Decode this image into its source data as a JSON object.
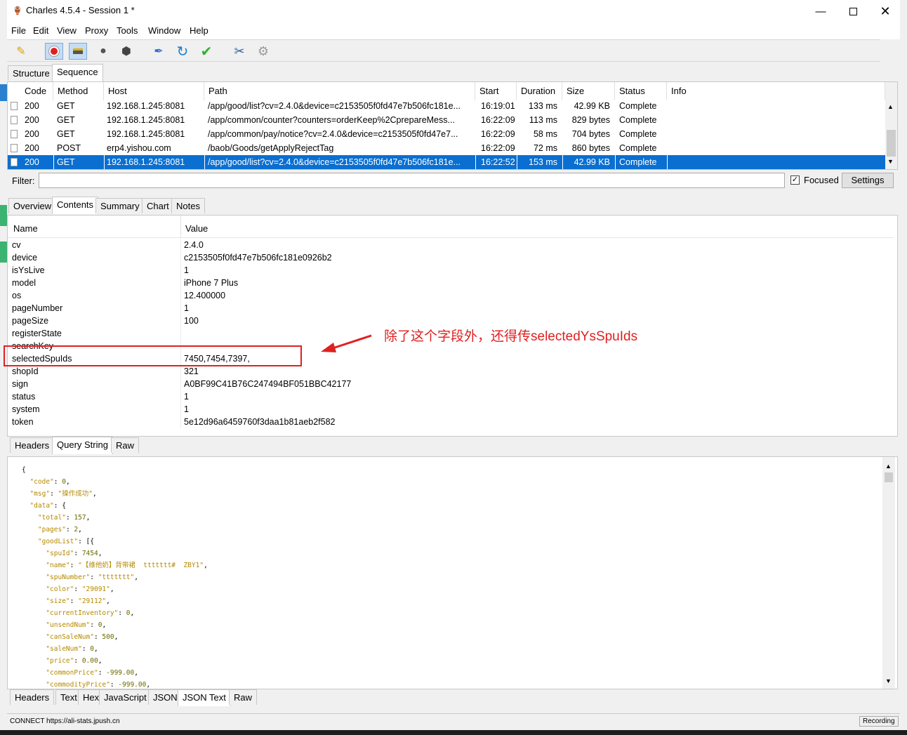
{
  "window": {
    "title": "Charles 4.5.4 - Session 1 *"
  },
  "menu": [
    "File",
    "Edit",
    "View",
    "Proxy",
    "Tools",
    "Window",
    "Help"
  ],
  "toolbar_icons": [
    "broom-icon",
    "record-icon",
    "throttle-icon",
    "turtle-icon",
    "stop-icon",
    "pen-icon",
    "refresh-icon",
    "check-icon",
    "tools-icon",
    "gear-icon"
  ],
  "top_tabs": [
    "Structure",
    "Sequence"
  ],
  "columns": [
    "Code",
    "Method",
    "Host",
    "Path",
    "Start",
    "Duration",
    "Size",
    "Status",
    "Info"
  ],
  "rows": [
    {
      "code": "200",
      "method": "GET",
      "host": "192.168.1.245:8081",
      "path": "/app/good/list?cv=2.4.0&device=c2153505f0fd47e7b506fc181e...",
      "start": "16:19:01",
      "duration": "133 ms",
      "size": "42.99 KB",
      "status": "Complete",
      "info": ""
    },
    {
      "code": "200",
      "method": "GET",
      "host": "192.168.1.245:8081",
      "path": "/app/common/counter?counters=orderKeep%2CprepareMess...",
      "start": "16:22:09",
      "duration": "113 ms",
      "size": "829 bytes",
      "status": "Complete",
      "info": ""
    },
    {
      "code": "200",
      "method": "GET",
      "host": "192.168.1.245:8081",
      "path": "/app/common/pay/notice?cv=2.4.0&device=c2153505f0fd47e7...",
      "start": "16:22:09",
      "duration": "58 ms",
      "size": "704 bytes",
      "status": "Complete",
      "info": ""
    },
    {
      "code": "200",
      "method": "POST",
      "host": "erp4.yishou.com",
      "path": "/baob/Goods/getApplyRejectTag",
      "start": "16:22:09",
      "duration": "72 ms",
      "size": "860 bytes",
      "status": "Complete",
      "info": ""
    },
    {
      "code": "200",
      "method": "GET",
      "host": "192.168.1.245:8081",
      "path": "/app/good/list?cv=2.4.0&device=c2153505f0fd47e7b506fc181e...",
      "start": "16:22:52",
      "duration": "153 ms",
      "size": "42.99 KB",
      "status": "Complete",
      "info": ""
    }
  ],
  "filter": {
    "label": "Filter:",
    "value": "",
    "focused": "Focused",
    "settings": "Settings"
  },
  "detail_tabs": [
    "Overview",
    "Contents",
    "Summary",
    "Chart",
    "Notes"
  ],
  "params_header": {
    "name": "Name",
    "value": "Value"
  },
  "params": [
    {
      "name": "cv",
      "value": "2.4.0"
    },
    {
      "name": "device",
      "value": "c2153505f0fd47e7b506fc181e0926b2"
    },
    {
      "name": "isYsLive",
      "value": "1"
    },
    {
      "name": "model",
      "value": "iPhone 7 Plus"
    },
    {
      "name": "os",
      "value": "12.400000"
    },
    {
      "name": "pageNumber",
      "value": "1"
    },
    {
      "name": "pageSize",
      "value": "100"
    },
    {
      "name": "registerState",
      "value": ""
    },
    {
      "name": "searchKey",
      "value": ""
    },
    {
      "name": "selectedSpuIds",
      "value": "7450,7454,7397,"
    },
    {
      "name": "shopId",
      "value": "321"
    },
    {
      "name": "sign",
      "value": "A0BF99C41B76C247494BF051BBC42177"
    },
    {
      "name": "status",
      "value": "1"
    },
    {
      "name": "system",
      "value": "1"
    },
    {
      "name": "token",
      "value": "5e12d96a6459760f3daa1b81aeb2f582"
    }
  ],
  "annotation": "除了这个字段外，还得传selectedYsSpuIds",
  "request_tabs": [
    "Headers",
    "Query String",
    "Raw"
  ],
  "json_lines": [
    "{",
    "  \"code\": 0,",
    "  \"msg\": \"操作成功\",",
    "  \"data\": {",
    "    \"total\": 157,",
    "    \"pages\": 2,",
    "    \"goodList\": [{",
    "      \"spuId\": 7454,",
    "      \"name\": \"【维他奶】背带裙  ttttttt#  ZBY1\",",
    "      \"spuNumber\": \"ttttttt\",",
    "      \"color\": \"29091\",",
    "      \"size\": \"29112\",",
    "      \"currentInventory\": 0,",
    "      \"unsendNum\": 0,",
    "      \"canSaleNum\": 500,",
    "      \"saleNum\": 0,",
    "      \"price\": 0.00,",
    "      \"commonPrice\": -999.00,",
    "      \"commodityPrice\": -999.00,"
  ],
  "response_tabs": [
    "Headers",
    "Text",
    "Hex",
    "JavaScript",
    "JSON",
    "JSON Text",
    "Raw"
  ],
  "status": {
    "left": "CONNECT https://ali-stats.jpush.cn",
    "right": "Recording"
  }
}
